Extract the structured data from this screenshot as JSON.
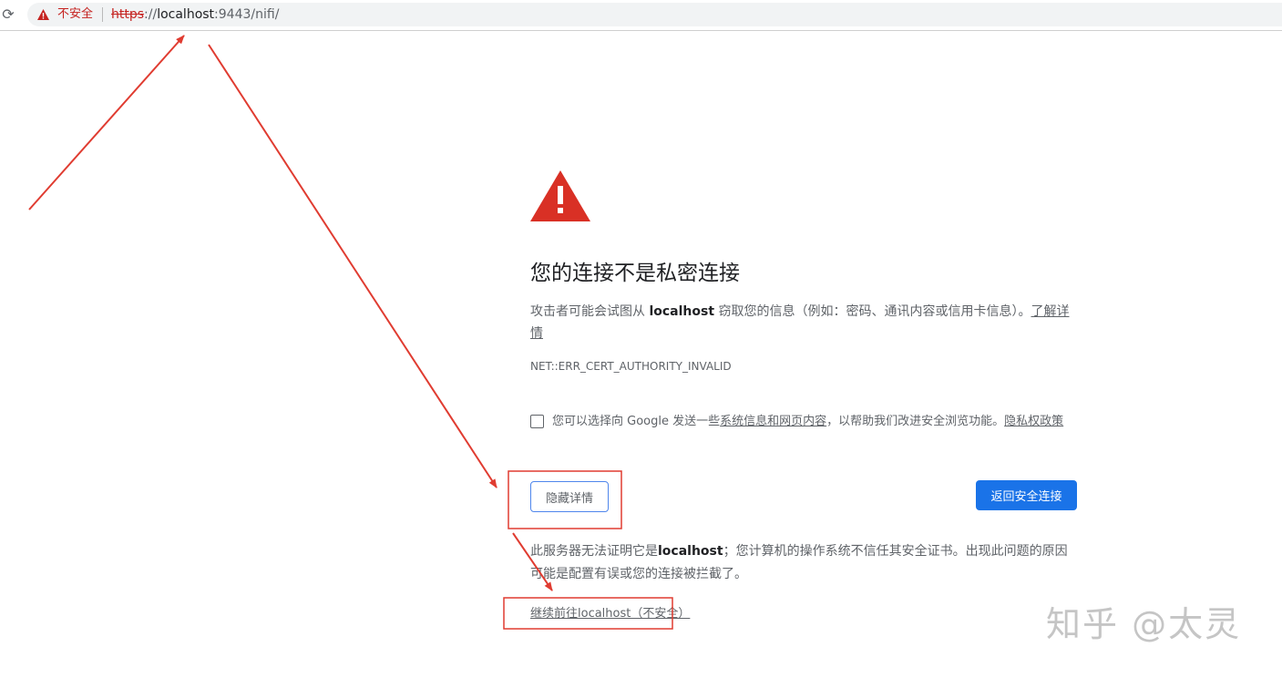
{
  "browser": {
    "reload_glyph": "⟳",
    "security_label": "不安全",
    "url_scheme": "https",
    "url_sep": "://",
    "url_host": "localhost",
    "url_rest": ":9443/nifi/"
  },
  "interstitial": {
    "heading": "您的连接不是私密连接",
    "desc_before": "攻击者可能会试图从 ",
    "desc_host": "localhost",
    "desc_after": " 窃取您的信息（例如：密码、通讯内容或信用卡信息）。",
    "learn_more": "了解详情",
    "error_code": "NET::ERR_CERT_AUTHORITY_INVALID",
    "optin_before": "您可以选择向 Google 发送一些",
    "optin_link": "系统信息和网页内容",
    "optin_after": "，以帮助我们改进安全浏览功能。",
    "privacy_link": "隐私权政策",
    "hide_details_button": "隐藏详情",
    "back_button": "返回安全连接",
    "details_before": "此服务器无法证明它是",
    "details_host": "localhost",
    "details_after": "；您计算机的操作系统不信任其安全证书。出现此问题的原因可能是配置有误或您的连接被拦截了。",
    "proceed_link": "继续前往localhost（不安全）"
  },
  "watermark": "知乎 @太灵",
  "colors": {
    "warning_red": "#d93025",
    "annotation_red": "#e03c31",
    "primary_blue": "#1a73e8"
  }
}
